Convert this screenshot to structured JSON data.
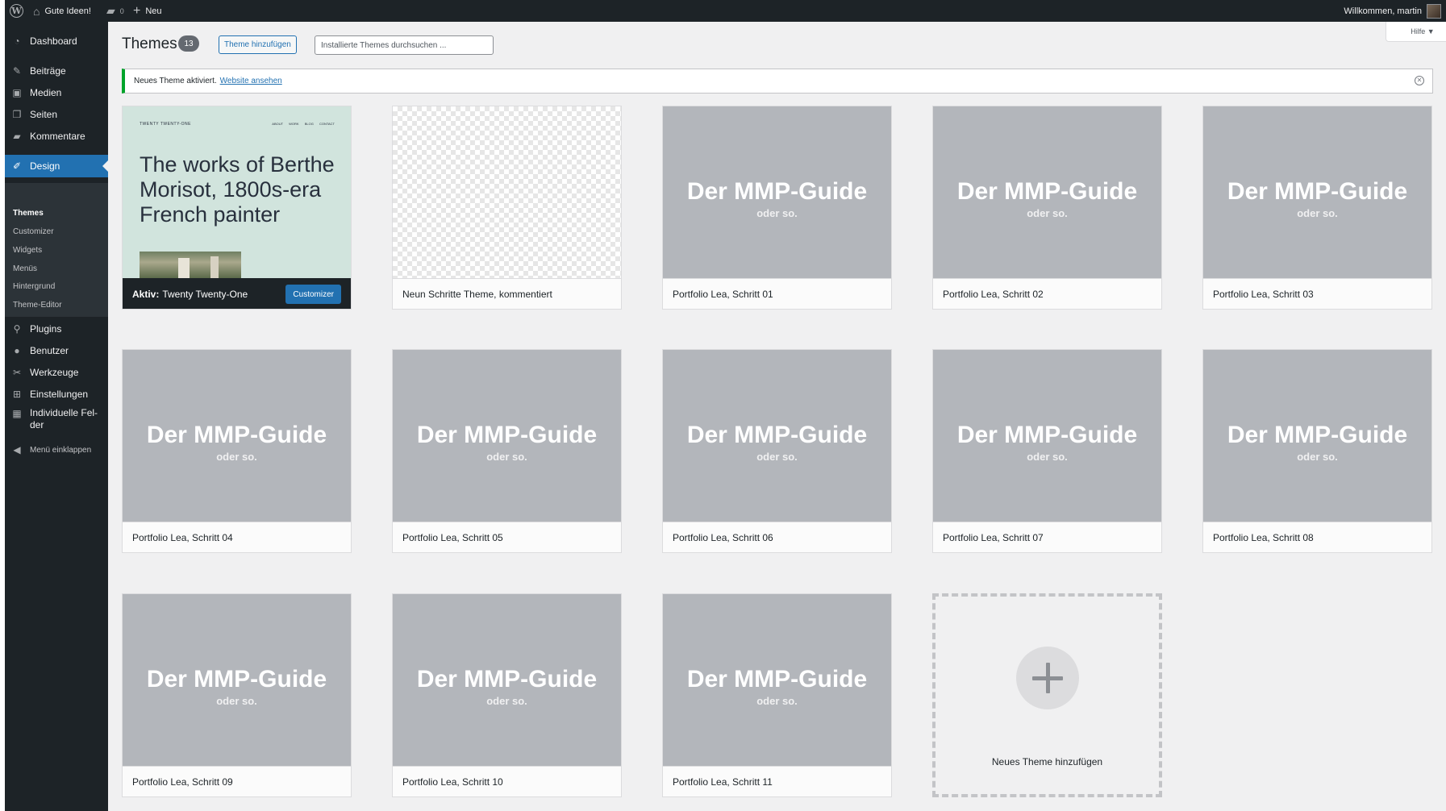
{
  "adminbar": {
    "site_name": "Gute Ideen!",
    "comments_count": "0",
    "new_label": "Neu",
    "greeting": "Willkommen, martin"
  },
  "sidebar": {
    "dashboard": "Dashboard",
    "posts": "Beiträge",
    "media": "Medien",
    "pages": "Seiten",
    "comments": "Kommentare",
    "design": "Design",
    "submenu": [
      "Themes",
      "Customizer",
      "Widgets",
      "Menüs",
      "Hintergrund",
      "Theme-Editor"
    ],
    "plugins": "Plugins",
    "users": "Benutzer",
    "tools": "Werkzeuge",
    "settings": "Einstellungen",
    "custom_fields_line1": "Individuelle Fel-",
    "custom_fields_line2": "der",
    "collapse": "Menü einklappen"
  },
  "header": {
    "title": "Themes",
    "count": "13",
    "add_button": "Theme hinzufügen",
    "search_placeholder": "Installierte Themes durchsuchen ...",
    "help": "Hilfe ▼"
  },
  "notice": {
    "text": "Neues Theme aktiviert.",
    "link": "Website ansehen"
  },
  "active_theme": {
    "brand": "TWENTY TWENTY-ONE",
    "nav": [
      "ABOUT",
      "WORK",
      "BLOG",
      "CONTACT"
    ],
    "headline": "The works of Berthe Morisot, 1800s-era French painter",
    "active_label": "Aktiv:",
    "name": "Twenty Twenty-One",
    "customize": "Customizer"
  },
  "checker_theme": {
    "name": "Neun Schritte Theme, kommentiert"
  },
  "placeholder": {
    "big": "Der MMP-Guide",
    "small": "oder so."
  },
  "themes": [
    "Portfolio Lea, Schritt 01",
    "Portfolio Lea, Schritt 02",
    "Portfolio Lea, Schritt 03",
    "Portfolio Lea, Schritt 04",
    "Portfolio Lea, Schritt 05",
    "Portfolio Lea, Schritt 06",
    "Portfolio Lea, Schritt 07",
    "Portfolio Lea, Schritt 08",
    "Portfolio Lea, Schritt 09",
    "Portfolio Lea, Schritt 10",
    "Portfolio Lea, Schritt 11"
  ],
  "add_new_theme": "Neues Theme hinzufügen",
  "colors": {
    "accent": "#2271b1",
    "adminbar": "#1d2327",
    "notice_success": "#00a32a",
    "placeholder_bg": "#b3b6bb"
  }
}
